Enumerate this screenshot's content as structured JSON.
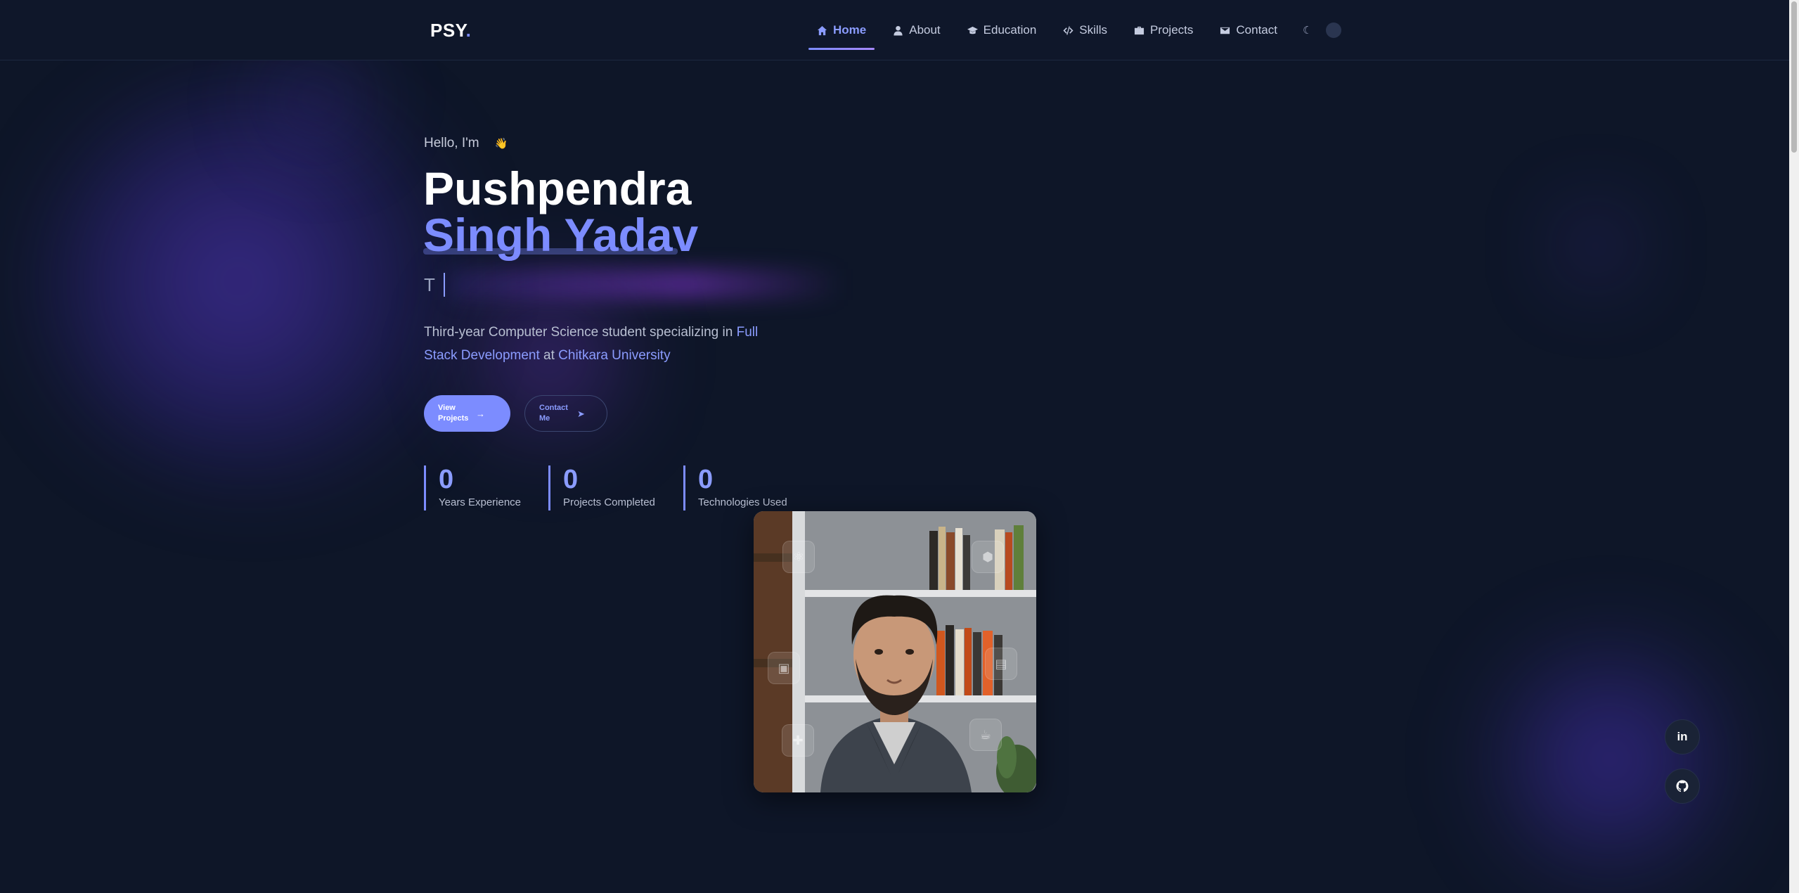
{
  "brand": {
    "logo_text": "PSY",
    "logo_dot": "."
  },
  "nav": {
    "items": [
      {
        "label": "Home",
        "icon": "home-icon",
        "active": true
      },
      {
        "label": "About",
        "icon": "user-icon",
        "active": false
      },
      {
        "label": "Education",
        "icon": "graduation-cap-icon",
        "active": false
      },
      {
        "label": "Skills",
        "icon": "code-icon",
        "active": false
      },
      {
        "label": "Projects",
        "icon": "briefcase-icon",
        "active": false
      },
      {
        "label": "Contact",
        "icon": "envelope-icon",
        "active": false
      }
    ],
    "theme_toggle_icon": "moon-icon"
  },
  "hero": {
    "greeting": "Hello, I'm",
    "greeting_emoji": "👋",
    "name_first": "Pushpendra",
    "name_last": "Singh Yadav",
    "typed_text": "T",
    "description_prefix": "Third-year Computer Science student specializing in ",
    "description_highlight_1": "Full Stack Development",
    "description_mid": " at ",
    "description_highlight_2": "Chitkara University",
    "primary_button": "View Projects",
    "secondary_button": "Contact Me"
  },
  "stats": [
    {
      "value": "0",
      "label": "Years Experience"
    },
    {
      "value": "0",
      "label": "Projects Completed"
    },
    {
      "value": "0",
      "label": "Technologies Used"
    }
  ],
  "social": [
    {
      "icon": "linkedin-icon",
      "glyph": "in"
    },
    {
      "icon": "github-icon"
    }
  ],
  "colors": {
    "background": "#0e1628",
    "accent": "#7c8cff",
    "navbar": "#0f172a"
  }
}
